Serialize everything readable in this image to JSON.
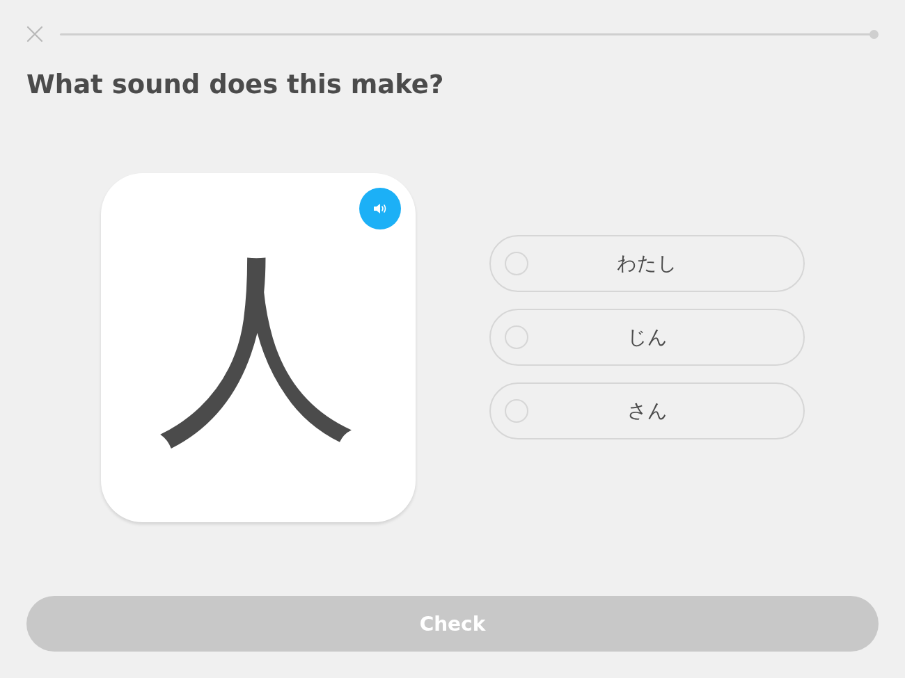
{
  "progress": {
    "level": 0
  },
  "prompt": "What sound does this make?",
  "card": {
    "character": "人"
  },
  "choices": [
    {
      "label": "わたし",
      "selected": false
    },
    {
      "label": "じん",
      "selected": false
    },
    {
      "label": "さん",
      "selected": false
    }
  ],
  "check_button": {
    "label": "Check",
    "disabled": true
  }
}
